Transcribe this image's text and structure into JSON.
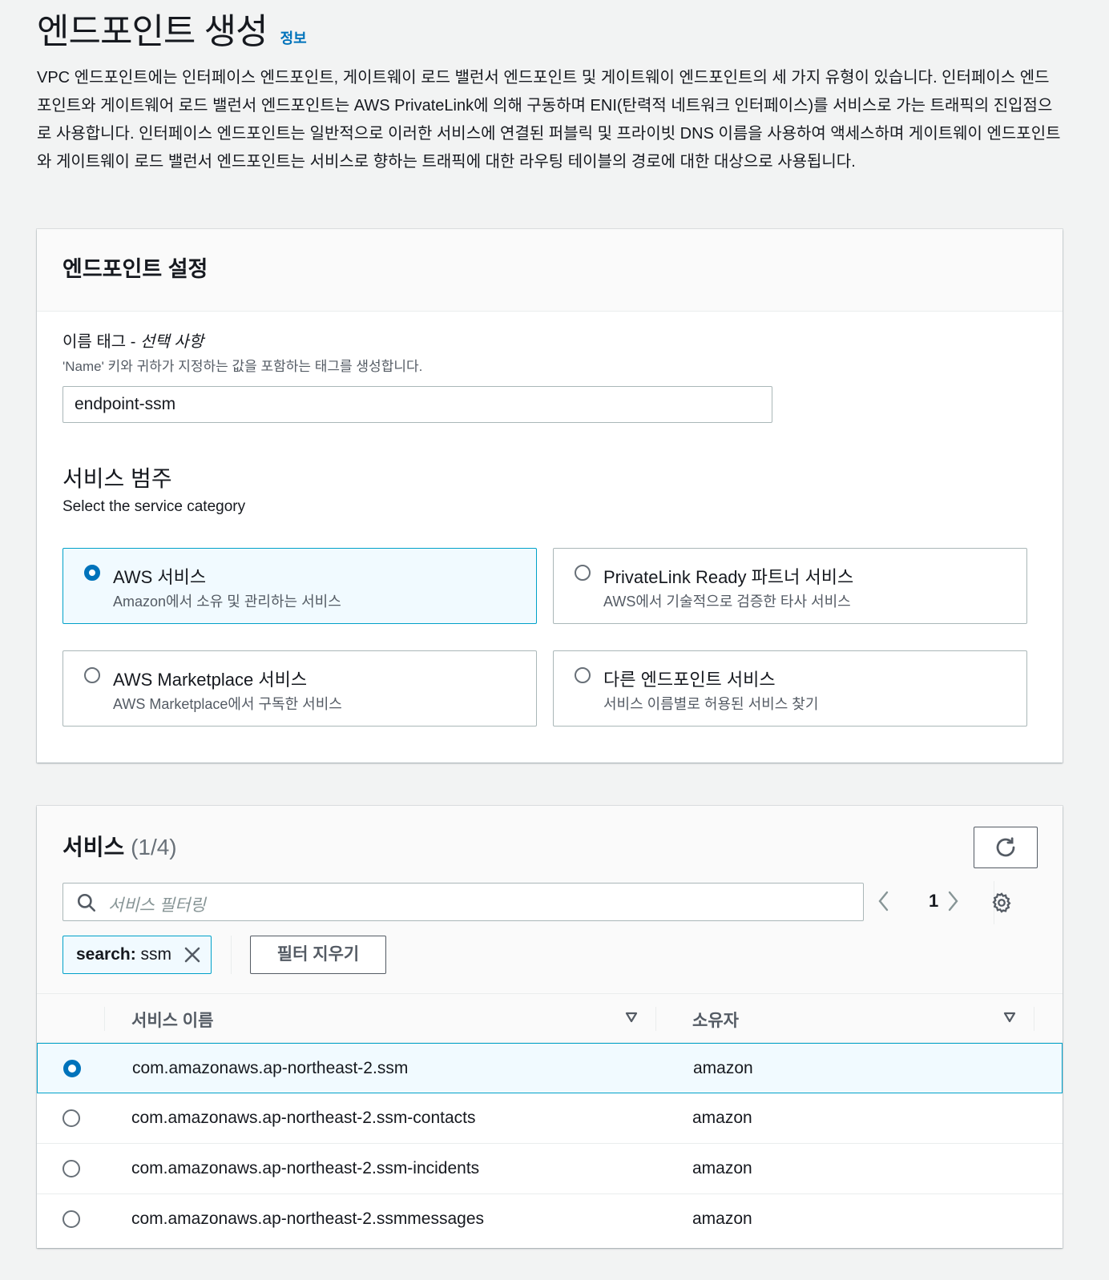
{
  "header": {
    "title": "엔드포인트 생성",
    "info_link": "정보",
    "description": "VPC 엔드포인트에는 인터페이스 엔드포인트, 게이트웨이 로드 밸런서 엔드포인트 및 게이트웨이 엔드포인트의 세 가지 유형이 있습니다. 인터페이스 엔드포인트와 게이트웨어 로드 밸런서 엔드포인트는 AWS PrivateLink에 의해 구동하며 ENI(탄력적 네트워크 인터페이스)를 서비스로 가는 트래픽의 진입점으로 사용합니다. 인터페이스 엔드포인트는 일반적으로 이러한 서비스에 연결된 퍼블릭 및 프라이빗 DNS 이름을 사용하여 액세스하며 게이트웨이 엔드포인트와 게이트웨이 로드 밸런서 엔드포인트는 서비스로 향하는 트래픽에 대한 라우팅 테이블의 경로에 대한 대상으로 사용됩니다."
  },
  "settings": {
    "title": "엔드포인트 설정",
    "name_tag_label": "이름 태그 - ",
    "name_tag_optional": "선택 사항",
    "name_tag_desc": "'Name' 키와 귀하가 지정하는 값을 포함하는 태그를 생성합니다.",
    "name_tag_value": "endpoint-ssm",
    "category_title": "서비스 범주",
    "category_desc": "Select the service category",
    "tiles": [
      {
        "label": "AWS 서비스",
        "desc": "Amazon에서 소유 및 관리하는 서비스",
        "selected": true
      },
      {
        "label": "PrivateLink Ready 파트너 서비스",
        "desc": "AWS에서 기술적으로 검증한 타사 서비스",
        "selected": false
      },
      {
        "label": "AWS Marketplace 서비스",
        "desc": "AWS Marketplace에서 구독한 서비스",
        "selected": false
      },
      {
        "label": "다른 엔드포인트 서비스",
        "desc": "서비스 이름별로 허용된 서비스 찾기",
        "selected": false
      }
    ]
  },
  "services": {
    "title": "서비스",
    "count": "(1/4)",
    "search_placeholder": "서비스 필터링",
    "page": "1",
    "token_key": "search:",
    "token_value": " ssm",
    "clear_filters": "필터 지우기",
    "columns": [
      "서비스 이름",
      "소유자"
    ],
    "rows": [
      {
        "name": "com.amazonaws.ap-northeast-2.ssm",
        "owner": "amazon",
        "selected": true
      },
      {
        "name": "com.amazonaws.ap-northeast-2.ssm-contacts",
        "owner": "amazon",
        "selected": false
      },
      {
        "name": "com.amazonaws.ap-northeast-2.ssm-incidents",
        "owner": "amazon",
        "selected": false
      },
      {
        "name": "com.amazonaws.ap-northeast-2.ssmmessages",
        "owner": "amazon",
        "selected": false
      }
    ]
  },
  "colors": {
    "accent": "#0073bb",
    "selected_bg": "#f1faff",
    "selected_border": "#00a1c9"
  },
  "icons": [
    "refresh-icon",
    "search-icon",
    "chevron-left-icon",
    "chevron-right-icon",
    "gear-icon",
    "close-icon",
    "sort-down-icon"
  ]
}
